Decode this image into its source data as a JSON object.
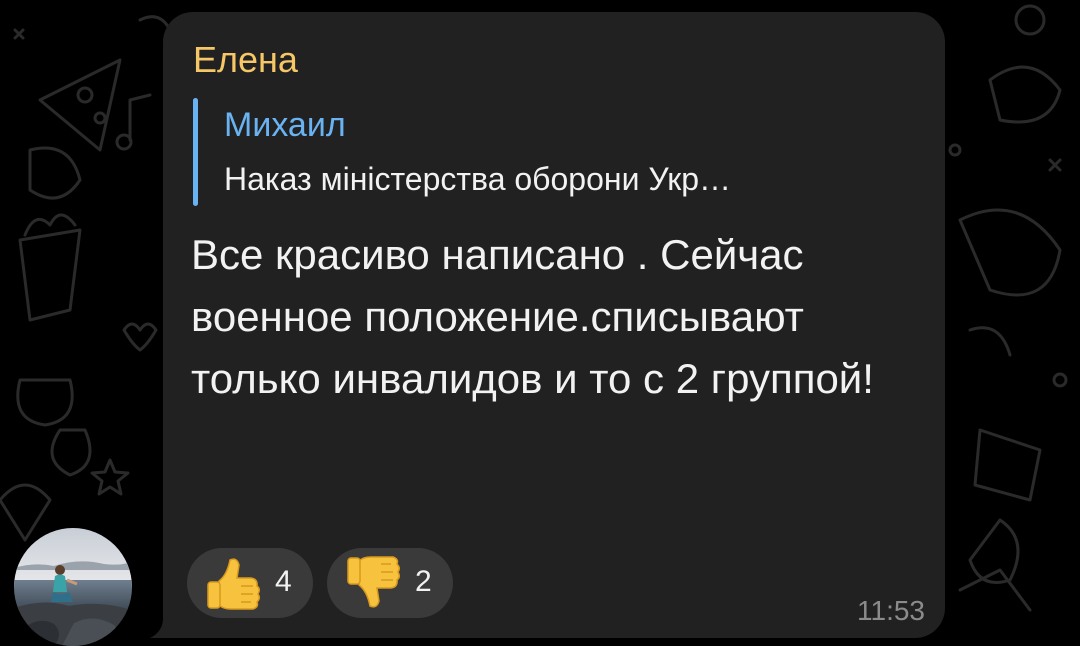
{
  "chat": {
    "background_color": "#000000",
    "bubble_color": "#212121"
  },
  "message": {
    "sender": "Елена",
    "sender_color": "#f6c767",
    "reply": {
      "author": "Михаил",
      "author_color": "#6ab3f3",
      "text": "Наказ міністерства оборони Укр…"
    },
    "text": "Все красиво написано . Сейчас военное положение.списывают только инвалидов и то с 2 группой!",
    "time": "11:53",
    "reactions": [
      {
        "emoji": "thumbs-up-icon",
        "count": "4"
      },
      {
        "emoji": "thumbs-down-icon",
        "count": "2"
      }
    ]
  },
  "avatar": {
    "icon": "user-photo-avatar"
  }
}
